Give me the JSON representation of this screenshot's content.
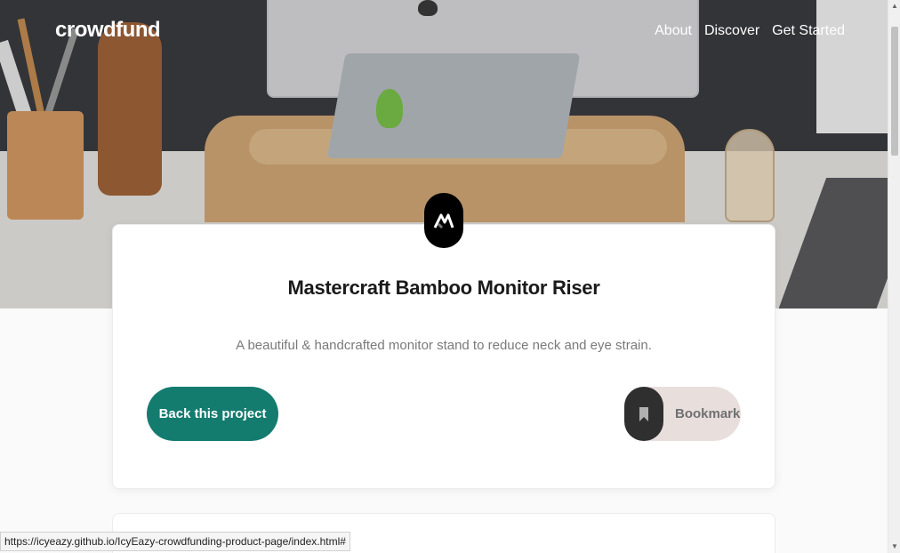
{
  "header": {
    "logo": "crowdfund",
    "nav": [
      "About",
      "Discover",
      "Get Started"
    ]
  },
  "hero": {
    "image": "desk-with-monitor-riser-photo"
  },
  "product": {
    "logo_icon": "mastercraft-logo-icon",
    "title": "Mastercraft Bamboo Monitor Riser",
    "subtitle": "A beautiful & handcrafted monitor stand to reduce neck and eye strain.",
    "back_button": "Back this project",
    "bookmark_button": "Bookmark"
  },
  "statusbar": {
    "url": "https://icyeazy.github.io/IcyEazy-crowdfunding-product-page/index.html#"
  },
  "colors": {
    "primary": "#147b6f",
    "bookmark_bg": "#e8dfdd",
    "dark": "#2f2f2f"
  }
}
